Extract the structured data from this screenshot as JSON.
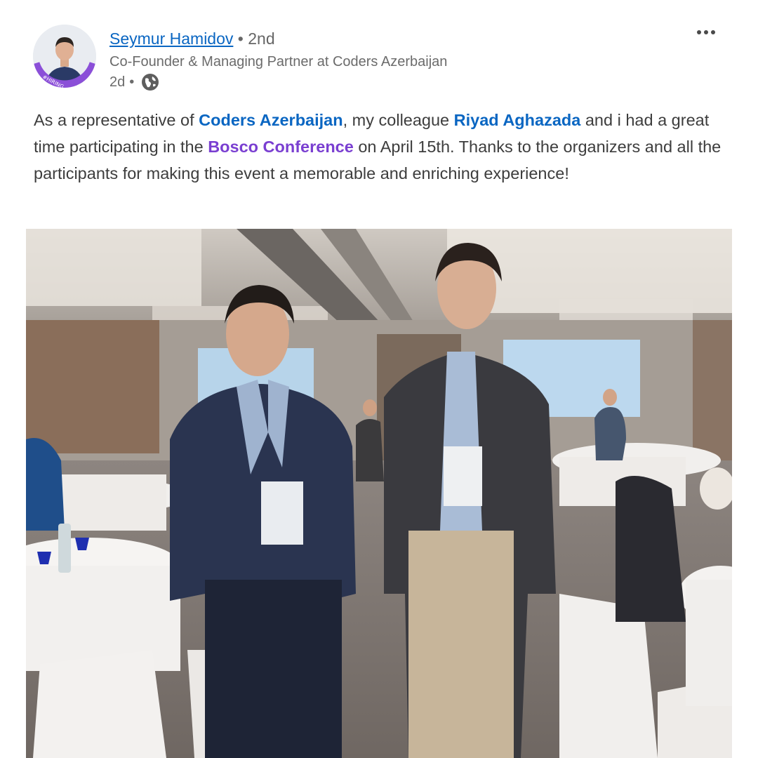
{
  "author": {
    "name": "Seymur Hamidov",
    "degree_separator": " • ",
    "degree": "2nd",
    "headline": "Co-Founder & Managing Partner at Coders Azerbaijan",
    "time": "2d",
    "time_separator": " •",
    "avatar_badge": "#HIRING"
  },
  "icons": {
    "visibility": "globe-icon",
    "more": "more-horizontal-icon"
  },
  "post": {
    "t1": "As a representative of ",
    "m1": "Coders Azerbaijan",
    "t2": ", my colleague ",
    "m2": "Riyad Aghazada",
    "t3": " and i had a great time participating in the ",
    "m3": "Bosco Conference",
    "t4": " on April 15th. Thanks to the organizers and all the participants for making this event a memorable and enriching experience!"
  },
  "colors": {
    "link_blue": "#0a66c2",
    "mention_purple": "#7a3fd1",
    "hiring_badge": "#8b4fd8"
  }
}
